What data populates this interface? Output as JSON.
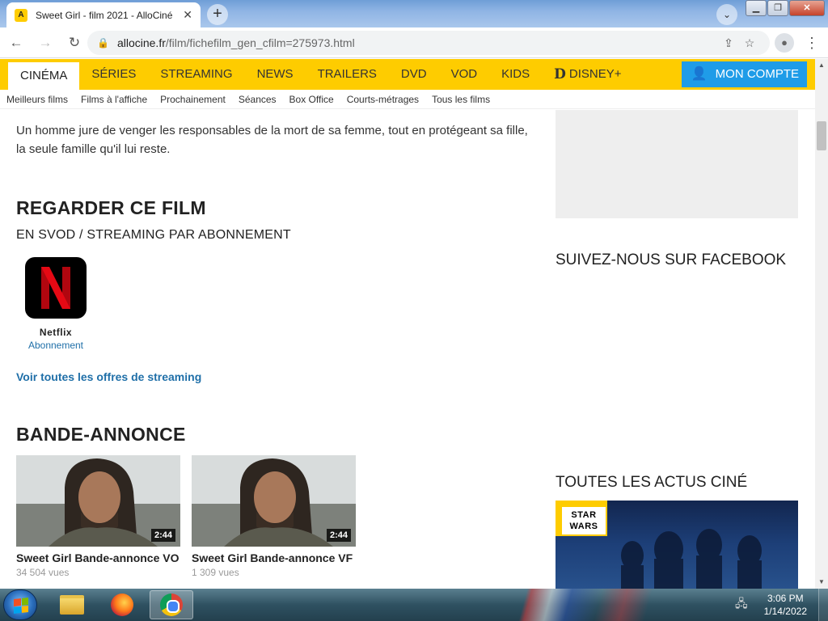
{
  "browser": {
    "tab": {
      "title": "Sweet Girl - film 2021 - AlloCiné",
      "favicon": "allocine-favicon",
      "close_glyph": "✕"
    },
    "new_tab_glyph": "+",
    "url_host": "allocine.fr",
    "url_path": "/film/fichefilm_gen_cfilm=275973.html",
    "window_buttons": {
      "minimize": "▭",
      "restore": "❐",
      "close": "✕"
    }
  },
  "site": {
    "nav": [
      {
        "label": "CINÉMA",
        "active": true
      },
      {
        "label": "SÉRIES"
      },
      {
        "label": "STREAMING"
      },
      {
        "label": "NEWS"
      },
      {
        "label": "TRAILERS"
      },
      {
        "label": "DVD"
      },
      {
        "label": "VOD"
      },
      {
        "label": "KIDS"
      }
    ],
    "disney": {
      "logo": "D",
      "label": "DISNEY+"
    },
    "account_label": "MON COMPTE",
    "subnav": [
      "Meilleurs films",
      "Films à l'affiche",
      "Prochainement",
      "Séances",
      "Box Office",
      "Courts-métrages",
      "Tous les films"
    ],
    "colors": {
      "nav_bg": "#fecc00",
      "account_bg": "#1f9ce8",
      "link": "#1f6fa8"
    }
  },
  "main": {
    "synopsis": "Un homme jure de venger les responsables de la mort de sa femme, tout en protégeant sa fille, la seule famille qu'il lui reste.",
    "watch_title": "REGARDER CE FILM",
    "watch_subtitle": "EN SVOD / STREAMING PAR ABONNEMENT",
    "provider": {
      "name": "Netflix",
      "type": "Abonnement",
      "logo_letter": "N"
    },
    "all_offers_link": "Voir toutes les offres de streaming",
    "trailers_title": "BANDE-ANNONCE",
    "trailers": [
      {
        "title": "Sweet Girl Bande-annonce VO",
        "duration": "2:44",
        "views": "34 504 vues"
      },
      {
        "title": "Sweet Girl Bande-annonce VF",
        "duration": "2:44",
        "views": "1 309 vues"
      }
    ]
  },
  "sidebar": {
    "facebook_title": "SUIVEZ-NOUS SUR FACEBOOK",
    "news_title": "TOUTES LES ACTUS CINÉ",
    "news_badge": "STAR\nWARS"
  },
  "taskbar": {
    "clock_time": "3:06 PM",
    "clock_date": "1/14/2022",
    "apps": [
      "explorer",
      "firefox",
      "chrome"
    ]
  }
}
